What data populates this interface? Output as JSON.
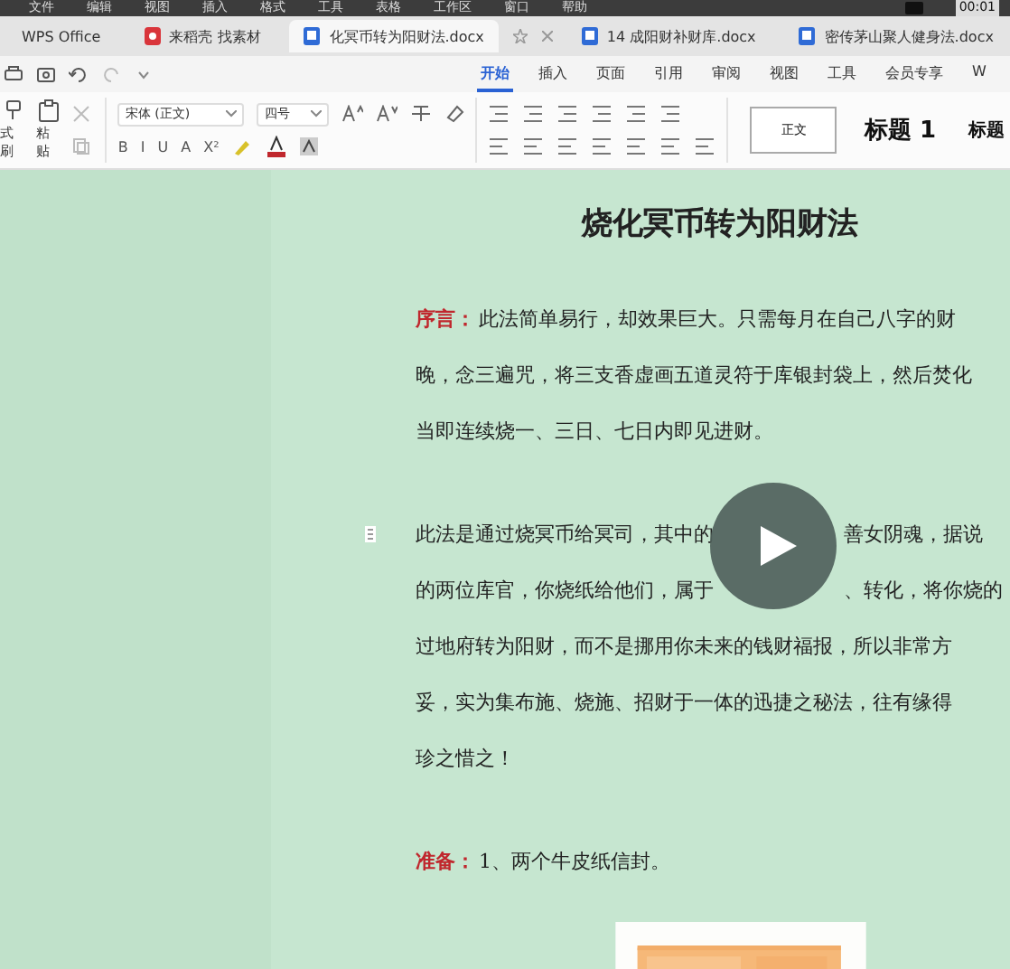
{
  "menu_bar": {
    "items": [
      "文件",
      "编辑",
      "视图",
      "插入",
      "格式",
      "工具",
      "表格",
      "工作区",
      "窗口",
      "帮助"
    ],
    "clock": "00:01"
  },
  "doc_tabs": [
    {
      "label": "WPS Office",
      "kind": "home",
      "selected": false
    },
    {
      "label": "来稻壳 找素材",
      "kind": "store",
      "selected": false
    },
    {
      "label": "化冥币转为阳财法.docx",
      "kind": "doc",
      "selected": true
    },
    {
      "label": "14 成阳财补财库.docx",
      "kind": "doc",
      "selected": false
    },
    {
      "label": "密传茅山聚人健身法.docx",
      "kind": "doc",
      "selected": false
    }
  ],
  "ribbon_tabs": [
    {
      "label": "开始",
      "selected": true
    },
    {
      "label": "插入",
      "selected": false
    },
    {
      "label": "页面",
      "selected": false
    },
    {
      "label": "引用",
      "selected": false
    },
    {
      "label": "审阅",
      "selected": false
    },
    {
      "label": "视图",
      "selected": false
    },
    {
      "label": "工具",
      "selected": false
    },
    {
      "label": "会员专享",
      "selected": false
    },
    {
      "label": "W",
      "selected": false
    }
  ],
  "toolbar": {
    "format_painter": "式刷",
    "paste": "粘贴",
    "font": "宋体 (正文)",
    "size": "四号",
    "format_buttons": [
      "B",
      "I",
      "U",
      "A",
      "X²"
    ],
    "styles": [
      {
        "label": "正文",
        "selected": true
      },
      {
        "label": "标题 1",
        "selected": false
      },
      {
        "label": "标题",
        "selected": false
      }
    ]
  },
  "document": {
    "title": "烧化冥币转为阳财法",
    "paragraphs": [
      {
        "lead": "序言：",
        "lines": [
          "此法简单易行，却效果巨大。只需每月在自己八字的财",
          "晚，念三遍咒，将三支香虚画五道灵符于库银封袋上，然后焚化",
          "当即连续烧一、三日、七日内即见进财。"
        ]
      },
      {
        "lines": [
          [
            "此法是通过烧冥币给冥司，其中的",
            "善女阴魂，据说"
          ],
          [
            "的两位库官，你烧纸给他们，属于",
            "、转化，将你烧的"
          ],
          "过地府转为阳财，而不是挪用你未来的钱财福报，所以非常方",
          "妥，实为集布施、烧施、招财于一体的迅捷之秘法，往有缘得",
          "珍之惜之！"
        ]
      },
      {
        "lead": "准备：",
        "lines": [
          "1、两个牛皮纸信封。"
        ]
      }
    ]
  },
  "video": {
    "playing": false
  }
}
